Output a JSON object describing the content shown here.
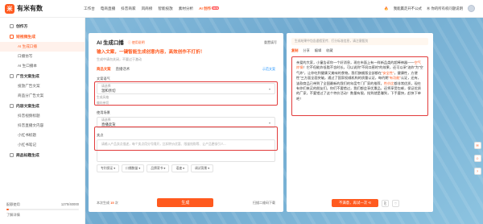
{
  "app": {
    "logo_char": "米",
    "name": "有米有数",
    "badge": "NEW"
  },
  "nav": [
    "工作台",
    "电商直播",
    "抖音商家",
    "风商榜",
    "智能投放",
    "素材分析",
    "AI 创作"
  ],
  "nav_active_index": 6,
  "top_right": {
    "link1": "我能赢走开不公式",
    "link2": "Ⓜ 你的所有权问题说明"
  },
  "sidebar": {
    "groups": [
      {
        "title": "创作方",
        "items": []
      },
      {
        "title": "短视频生成",
        "red": true,
        "items": [
          "AI 生成口播",
          "口播仿写",
          "AI 生口播本"
        ]
      },
      {
        "title": "广告文案生成",
        "items": [
          "投放广告文案",
          "商品分广告文案"
        ]
      },
      {
        "title": "内容文案生成",
        "items": [
          "抖音视频标题",
          "抖音直播文内容",
          "小红书标题",
          "小红书笔记"
        ]
      },
      {
        "title": "商品标题生成",
        "items": []
      }
    ],
    "active_item": "AI 生成口播",
    "quota_label": "配额使用",
    "quota_value": "1270/40000",
    "quota_fraction": 0.032,
    "bottom_link": "了解详情"
  },
  "main": {
    "title": "AI 生成口播",
    "sub": "使用说明",
    "top_link": "重置填写",
    "hero": "输入文案，一键智能生成创意内容，高效创作不打折！",
    "hero_sub": "生成中请勿关闭，不要过于激动",
    "tabs": [
      "商品文案",
      "直播话术"
    ],
    "tab_right": "示范文案",
    "field1_label": "文案语气",
    "field1_select_label": "请选择",
    "field1_value": "温和亲切",
    "field1_hint": "生成风格",
    "field1_hint_val": "偏向亲切",
    "field2_label": "使用场景",
    "field2_select_label": "请选择",
    "field2_value": "直播卖货",
    "field3_label": "卖点",
    "textarea_placeholder": "请输入产品卖点描述，每个卖点用分号隔开，比如特价优惠、限量抢购等、让产品更吸引人...",
    "tags": [
      "专利保证 ▾",
      "口播数量 ▾",
      "品牌背书 ▾",
      "语速 ▾",
      "调试背景 ▾"
    ],
    "foot_left": "本次生成",
    "foot_count": "15",
    "foot_left_suffix": "次",
    "gen_button": "生成",
    "foot_right": "扫描二维码下载"
  },
  "result": {
    "banner": "生成结果中包含虚假宣传、打分标准信息，请注意甄别",
    "tabs": [
      "复制",
      "分享",
      "编辑",
      "收藏"
    ],
    "text_parts": [
      {
        "t": "亲爱的大家，小童告诉你一个好消息，现在市面上有一样新品类的超棒神器——"
      },
      {
        "t": "空气炸锅",
        "hl": true
      },
      {
        "t": "！它不但能炸低脂不含时长，可以说到“不同口感的”的效果，还可以采“油炸”为“空气炸”，让你吃到健康又美味的食物。我们旗舰版全部都在"
      },
      {
        "t": "“安全性”",
        "hl": true
      },
      {
        "t": "，健康性，方便性”三方面全面突破。通过了国家权威机构的质量认证，每约期",
        "hl": false
      },
      {
        "t": "“有功能”",
        "hl": true
      },
      {
        "t": "认证，还有，该款商品已带到了全国最新的我们的年度专门厂家的推荐，"
      },
      {
        "t": "性价比",
        "hl": true
      },
      {
        "t": "都非常优质，现在有你们来买的朋友们，你们不要错过，我们都会享优惠品，还将享受包邮，保证优质的厂家，不要错过了这个特价活动！数量有限，抢到就是赚到，下手要快，赶快下单吧！"
      }
    ],
    "regen_button": "不满意，再试一次 ⟲",
    "icons": [
      "⎘",
      "♡"
    ]
  },
  "rail": [
    "✉",
    "☺",
    "?"
  ]
}
